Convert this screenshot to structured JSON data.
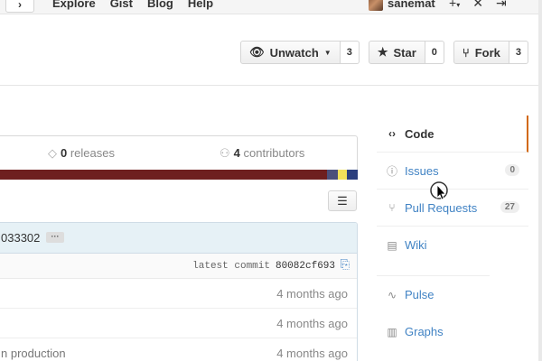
{
  "header": {
    "nav_toggle_glyph": "›",
    "nav": [
      "Explore",
      "Gist",
      "Blog",
      "Help"
    ],
    "username": "sanemat",
    "icons": [
      "plus-icon",
      "tools-icon",
      "sign-out-icon"
    ]
  },
  "repo_actions": {
    "watch": {
      "label": "Unwatch",
      "count": "3"
    },
    "star": {
      "label": "Star",
      "count": "0"
    },
    "fork": {
      "label": "Fork",
      "count": "3"
    }
  },
  "stats": {
    "releases_count": "0",
    "releases_label": " releases",
    "contributors_count": "4",
    "contributors_label": " contributors"
  },
  "language_bar": [
    {
      "color": "#6e1f1f",
      "share": 91.5
    },
    {
      "color": "#4b4f7a",
      "share": 3.0
    },
    {
      "color": "#f1e05a",
      "share": 2.5
    },
    {
      "color": "#2b3f7e",
      "share": 3.0
    }
  ],
  "commit": {
    "sha_tail": "033302",
    "ellipsis": "···",
    "latest_label": "latest commit",
    "latest_sha": "80082cf693"
  },
  "files": [
    {
      "message": "",
      "age": "4 months ago"
    },
    {
      "message": "",
      "age": "4 months ago"
    },
    {
      "message": "n production",
      "age": "4 months ago"
    }
  ],
  "sidebar": {
    "items": [
      {
        "label": "Code",
        "icon": "code-icon",
        "badge": ""
      },
      {
        "label": "Issues",
        "icon": "issue-icon",
        "badge": "0"
      },
      {
        "label": "Pull Requests",
        "icon": "pull-request-icon",
        "badge": "27"
      },
      {
        "label": "Wiki",
        "icon": "book-icon",
        "badge": ""
      },
      {
        "label": "Pulse",
        "icon": "pulse-icon",
        "badge": ""
      },
      {
        "label": "Graphs",
        "icon": "graph-icon",
        "badge": ""
      }
    ]
  }
}
